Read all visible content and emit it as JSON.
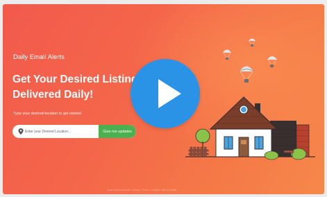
{
  "hero": {
    "eyebrow": "Daily Email Alerts",
    "headline_line1": "Get Your Desired Listings",
    "headline_line2": "Delivered Daily!",
    "hint": "Type your desired location to get started"
  },
  "search": {
    "placeholder": "Enter your Desired Location...",
    "button_label": "Give me updates"
  },
  "footer": {
    "text": "Some rights reserved · Privacy · Terms · Contact · Site by Tectite"
  },
  "video": {
    "play_icon": "play-icon"
  },
  "colors": {
    "background_start": "#f25a4c",
    "background_end": "#f6884b",
    "accent_green": "#4caf50",
    "play_blue": "#2b93e6",
    "house_wall": "#ffffff",
    "roof": "#7a3e2b",
    "chimney": "#3a2f2f"
  }
}
